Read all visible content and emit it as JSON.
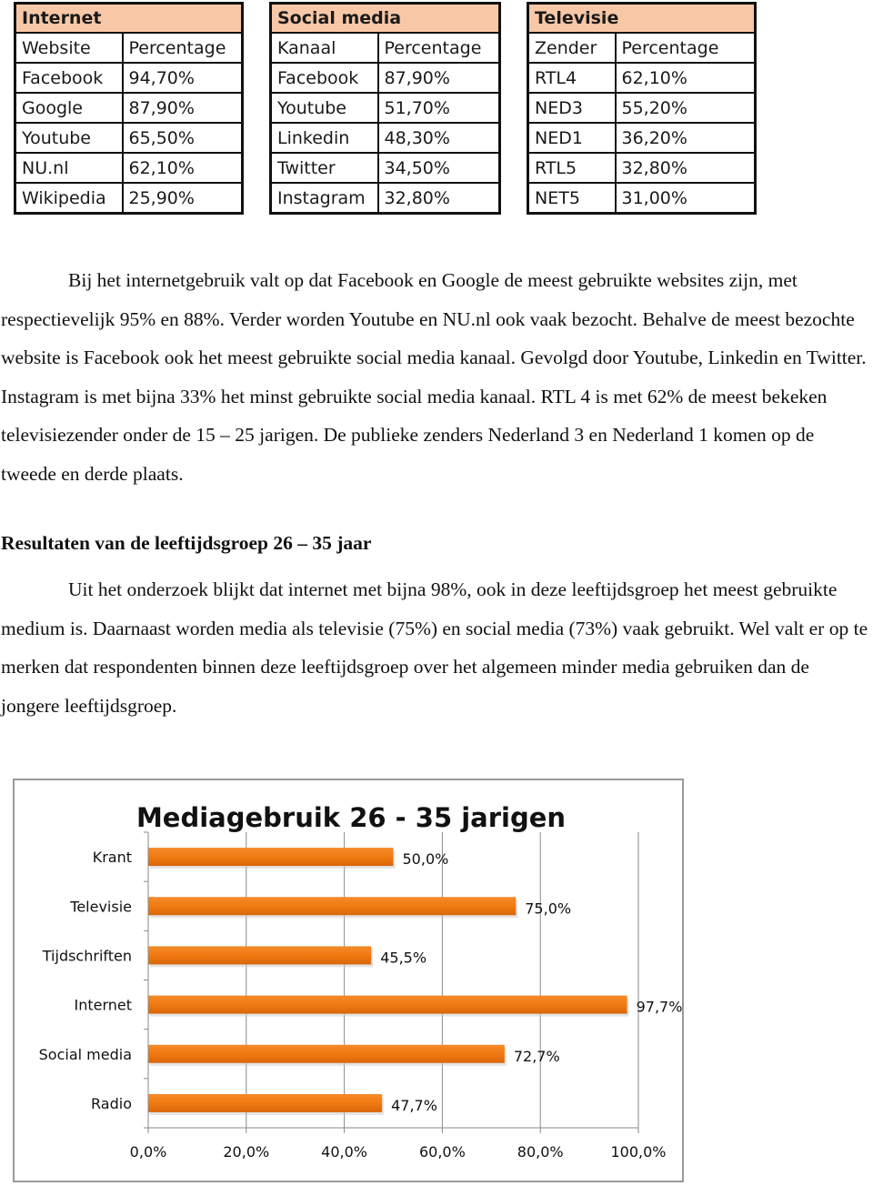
{
  "tables": [
    {
      "title": "Internet",
      "headers": [
        "Website",
        "Percentage"
      ],
      "rows": [
        [
          "Facebook",
          "94,70%"
        ],
        [
          "Google",
          "87,90%"
        ],
        [
          "Youtube",
          "65,50%"
        ],
        [
          "NU.nl",
          "62,10%"
        ],
        [
          "Wikipedia",
          "25,90%"
        ]
      ]
    },
    {
      "title": "Social media",
      "headers": [
        "Kanaal",
        "Percentage"
      ],
      "rows": [
        [
          "Facebook",
          "87,90%"
        ],
        [
          "Youtube",
          "51,70%"
        ],
        [
          "Linkedin",
          "48,30%"
        ],
        [
          "Twitter",
          "34,50%"
        ],
        [
          "Instagram",
          "32,80%"
        ]
      ]
    },
    {
      "title": "Televisie",
      "headers": [
        "Zender",
        "Percentage"
      ],
      "rows": [
        [
          "RTL4",
          "62,10%"
        ],
        [
          "NED3",
          "55,20%"
        ],
        [
          "NED1",
          "36,20%"
        ],
        [
          "RTL5",
          "32,80%"
        ],
        [
          "NET5",
          "31,00%"
        ]
      ]
    }
  ],
  "table_header_color": "#f8c8a6",
  "paragraph1": "Bij het internetgebruik valt op dat Facebook en Google de meest gebruikte websites zijn, met respectievelijk 95% en 88%. Verder worden Youtube en NU.nl ook vaak bezocht. Behalve de meest bezochte website is Facebook ook het meest gebruikte social media kanaal. Gevolgd door Youtube, Linkedin en Twitter. Instagram is met bijna 33% het minst gebruikte social media kanaal. RTL 4 is met 62% de meest bekeken televisiezender onder de 15 – 25 jarigen. De publieke zenders Nederland 3 en Nederland 1 komen op de tweede en derde plaats.",
  "heading2": "Resultaten van de leeftijdsgroep 26 – 35 jaar",
  "paragraph2": "Uit het onderzoek blijkt dat internet met bijna 98%, ook in deze leeftijdsgroep het meest gebruikte medium is. Daarnaast worden media als televisie (75%) en social media (73%) vaak gebruikt. Wel valt er op te merken dat respondenten binnen deze leeftijdsgroep over het algemeen minder media gebruiken dan de jongere leeftijdsgroep.",
  "chart_data": {
    "type": "bar",
    "orientation": "horizontal",
    "title": "Mediagebruik 26 - 35 jarigen",
    "categories": [
      "Krant",
      "Televisie",
      "Tijdschriften",
      "Internet",
      "Social media",
      "Radio"
    ],
    "values": [
      50.0,
      75.0,
      45.5,
      97.7,
      72.7,
      47.7
    ],
    "data_labels": [
      "50,0%",
      "75,0%",
      "45,5%",
      "97,7%",
      "72,7%",
      "47,7%"
    ],
    "xlabel": "",
    "ylabel": "",
    "xlim": [
      0,
      100
    ],
    "x_ticks": [
      0,
      20,
      40,
      60,
      80,
      100
    ],
    "x_tick_labels": [
      "0,0%",
      "20,0%",
      "40,0%",
      "60,0%",
      "80,0%",
      "100,0%"
    ],
    "grid": "vertical",
    "legend": "none",
    "bar_color": "#f07a10"
  }
}
